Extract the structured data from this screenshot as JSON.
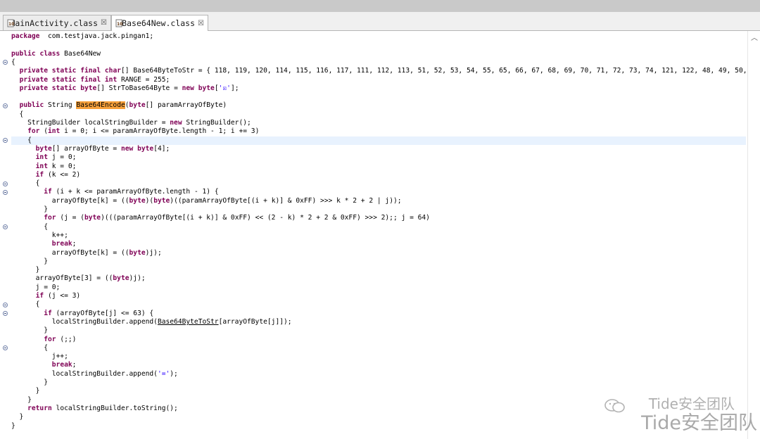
{
  "tabs": [
    {
      "label": "MainActivity.class",
      "close": "☒",
      "active": false
    },
    {
      "label": "Base64New.class",
      "close": "☒",
      "active": true
    }
  ],
  "code": [
    {
      "parts": [
        [
          "kw",
          "package"
        ],
        [
          "",
          "  com.testjava.jack.pingan1;"
        ]
      ]
    },
    {
      "parts": [
        [
          "",
          ""
        ]
      ]
    },
    {
      "parts": [
        [
          "kw",
          "public"
        ],
        [
          "",
          " "
        ],
        [
          "kw",
          "class"
        ],
        [
          "",
          " Base64New"
        ]
      ]
    },
    {
      "parts": [
        [
          "",
          "{"
        ]
      ]
    },
    {
      "parts": [
        [
          "",
          "  "
        ],
        [
          "kw",
          "private"
        ],
        [
          "",
          " "
        ],
        [
          "kw",
          "static"
        ],
        [
          "",
          " "
        ],
        [
          "kw",
          "final"
        ],
        [
          "",
          " "
        ],
        [
          "kw",
          "char"
        ],
        [
          "",
          "[] Base64ByteToStr = { 118, 119, 120, 114, 115, 116, 117, 111, 112, 113, 51, 52, 53, 54, 55, 65, 66, 67, 68, 69, 70, 71, 72, 73, 74, 121, 122, 48, 49, 50,"
        ]
      ]
    },
    {
      "parts": [
        [
          "",
          "  "
        ],
        [
          "kw",
          "private"
        ],
        [
          "",
          " "
        ],
        [
          "kw",
          "static"
        ],
        [
          "",
          " "
        ],
        [
          "kw",
          "final"
        ],
        [
          "",
          " "
        ],
        [
          "kw",
          "int"
        ],
        [
          "",
          " RANGE = 255;"
        ]
      ]
    },
    {
      "parts": [
        [
          "",
          "  "
        ],
        [
          "kw",
          "private"
        ],
        [
          "",
          " "
        ],
        [
          "kw",
          "static"
        ],
        [
          "",
          " "
        ],
        [
          "kw",
          "byte"
        ],
        [
          "",
          "[] StrToBase64Byte = "
        ],
        [
          "kw",
          "new"
        ],
        [
          "",
          " "
        ],
        [
          "kw",
          "byte"
        ],
        [
          "",
          "["
        ],
        [
          "str",
          "'☒'"
        ],
        [
          "",
          "];"
        ]
      ]
    },
    {
      "parts": [
        [
          "",
          ""
        ]
      ]
    },
    {
      "parts": [
        [
          "",
          "  "
        ],
        [
          "kw",
          "public"
        ],
        [
          "",
          " String "
        ],
        [
          "hl",
          "Base64Encode"
        ],
        [
          "",
          "("
        ],
        [
          "kw",
          "byte"
        ],
        [
          "",
          "[] paramArrayOfByte)"
        ]
      ]
    },
    {
      "parts": [
        [
          "",
          "  {"
        ]
      ]
    },
    {
      "parts": [
        [
          "",
          "    StringBuilder localStringBuilder = "
        ],
        [
          "kw",
          "new"
        ],
        [
          "",
          " StringBuilder();"
        ]
      ]
    },
    {
      "parts": [
        [
          "",
          "    "
        ],
        [
          "kw",
          "for"
        ],
        [
          "",
          " ("
        ],
        [
          "kw",
          "int"
        ],
        [
          "",
          " i = 0; i <= paramArrayOfByte.length - 1; i += 3)"
        ]
      ]
    },
    {
      "parts": [
        [
          "",
          "    {"
        ]
      ],
      "highlight": true
    },
    {
      "parts": [
        [
          "",
          "      "
        ],
        [
          "kw",
          "byte"
        ],
        [
          "",
          "[] arrayOfByte = "
        ],
        [
          "kw",
          "new"
        ],
        [
          "",
          " "
        ],
        [
          "kw",
          "byte"
        ],
        [
          "",
          "[4];"
        ]
      ]
    },
    {
      "parts": [
        [
          "",
          "      "
        ],
        [
          "kw",
          "int"
        ],
        [
          "",
          " j = 0;"
        ]
      ]
    },
    {
      "parts": [
        [
          "",
          "      "
        ],
        [
          "kw",
          "int"
        ],
        [
          "",
          " k = 0;"
        ]
      ]
    },
    {
      "parts": [
        [
          "",
          "      "
        ],
        [
          "kw",
          "if"
        ],
        [
          "",
          " (k <= 2)"
        ]
      ]
    },
    {
      "parts": [
        [
          "",
          "      {"
        ]
      ]
    },
    {
      "parts": [
        [
          "",
          "        "
        ],
        [
          "kw",
          "if"
        ],
        [
          "",
          " (i + k <= paramArrayOfByte.length - 1) {"
        ]
      ]
    },
    {
      "parts": [
        [
          "",
          "          arrayOfByte[k] = (("
        ],
        [
          "kw",
          "byte"
        ],
        [
          "",
          ")("
        ],
        [
          "kw",
          "byte"
        ],
        [
          "",
          ")((paramArrayOfByte[(i + k)] & 0xFF) >>> k * 2 + 2 | j));"
        ]
      ]
    },
    {
      "parts": [
        [
          "",
          "        }"
        ]
      ]
    },
    {
      "parts": [
        [
          "",
          "        "
        ],
        [
          "kw",
          "for"
        ],
        [
          "",
          " (j = ("
        ],
        [
          "kw",
          "byte"
        ],
        [
          "",
          ")(((paramArrayOfByte[(i + k)] & 0xFF) << (2 - k) * 2 + 2 & 0xFF) >>> 2);; j = 64)"
        ]
      ]
    },
    {
      "parts": [
        [
          "",
          "        {"
        ]
      ]
    },
    {
      "parts": [
        [
          "",
          "          k++;"
        ]
      ]
    },
    {
      "parts": [
        [
          "",
          "          "
        ],
        [
          "kw",
          "break"
        ],
        [
          "",
          ";"
        ]
      ]
    },
    {
      "parts": [
        [
          "",
          "          arrayOfByte[k] = (("
        ],
        [
          "kw",
          "byte"
        ],
        [
          "",
          ")j);"
        ]
      ]
    },
    {
      "parts": [
        [
          "",
          "        }"
        ]
      ]
    },
    {
      "parts": [
        [
          "",
          "      }"
        ]
      ]
    },
    {
      "parts": [
        [
          "",
          "      arrayOfByte[3] = (("
        ],
        [
          "kw",
          "byte"
        ],
        [
          "",
          ")j);"
        ]
      ]
    },
    {
      "parts": [
        [
          "",
          "      j = 0;"
        ]
      ]
    },
    {
      "parts": [
        [
          "",
          "      "
        ],
        [
          "kw",
          "if"
        ],
        [
          "",
          " (j <= 3)"
        ]
      ]
    },
    {
      "parts": [
        [
          "",
          "      {"
        ]
      ]
    },
    {
      "parts": [
        [
          "",
          "        "
        ],
        [
          "kw",
          "if"
        ],
        [
          "",
          " (arrayOfByte[j] <= 63) {"
        ]
      ]
    },
    {
      "parts": [
        [
          "",
          "          localStringBuilder.append("
        ],
        [
          "ul",
          "Base64ByteToStr"
        ],
        [
          "",
          "[arrayOfByte[j]]);"
        ]
      ]
    },
    {
      "parts": [
        [
          "",
          "        }"
        ]
      ]
    },
    {
      "parts": [
        [
          "",
          "        "
        ],
        [
          "kw",
          "for"
        ],
        [
          "",
          " (;;)"
        ]
      ]
    },
    {
      "parts": [
        [
          "",
          "        {"
        ]
      ]
    },
    {
      "parts": [
        [
          "",
          "          j++;"
        ]
      ]
    },
    {
      "parts": [
        [
          "",
          "          "
        ],
        [
          "kw",
          "break"
        ],
        [
          "",
          ";"
        ]
      ]
    },
    {
      "parts": [
        [
          "",
          "          localStringBuilder.append("
        ],
        [
          "str",
          "'='"
        ],
        [
          "",
          ");"
        ]
      ]
    },
    {
      "parts": [
        [
          "",
          "        }"
        ]
      ]
    },
    {
      "parts": [
        [
          "",
          "      }"
        ]
      ]
    },
    {
      "parts": [
        [
          "",
          "    }"
        ]
      ]
    },
    {
      "parts": [
        [
          "",
          "    "
        ],
        [
          "kw",
          "return"
        ],
        [
          "",
          " localStringBuilder.toString();"
        ]
      ]
    },
    {
      "parts": [
        [
          "",
          "  }"
        ]
      ]
    },
    {
      "parts": [
        [
          "",
          "}"
        ]
      ]
    }
  ],
  "fold_lines": [
    3,
    8,
    12,
    17,
    18,
    22,
    31,
    32,
    36
  ],
  "watermark": {
    "text1": "Tide安全团队",
    "text2": "Tide安全团队"
  },
  "scroll_up_glyph": "︿"
}
